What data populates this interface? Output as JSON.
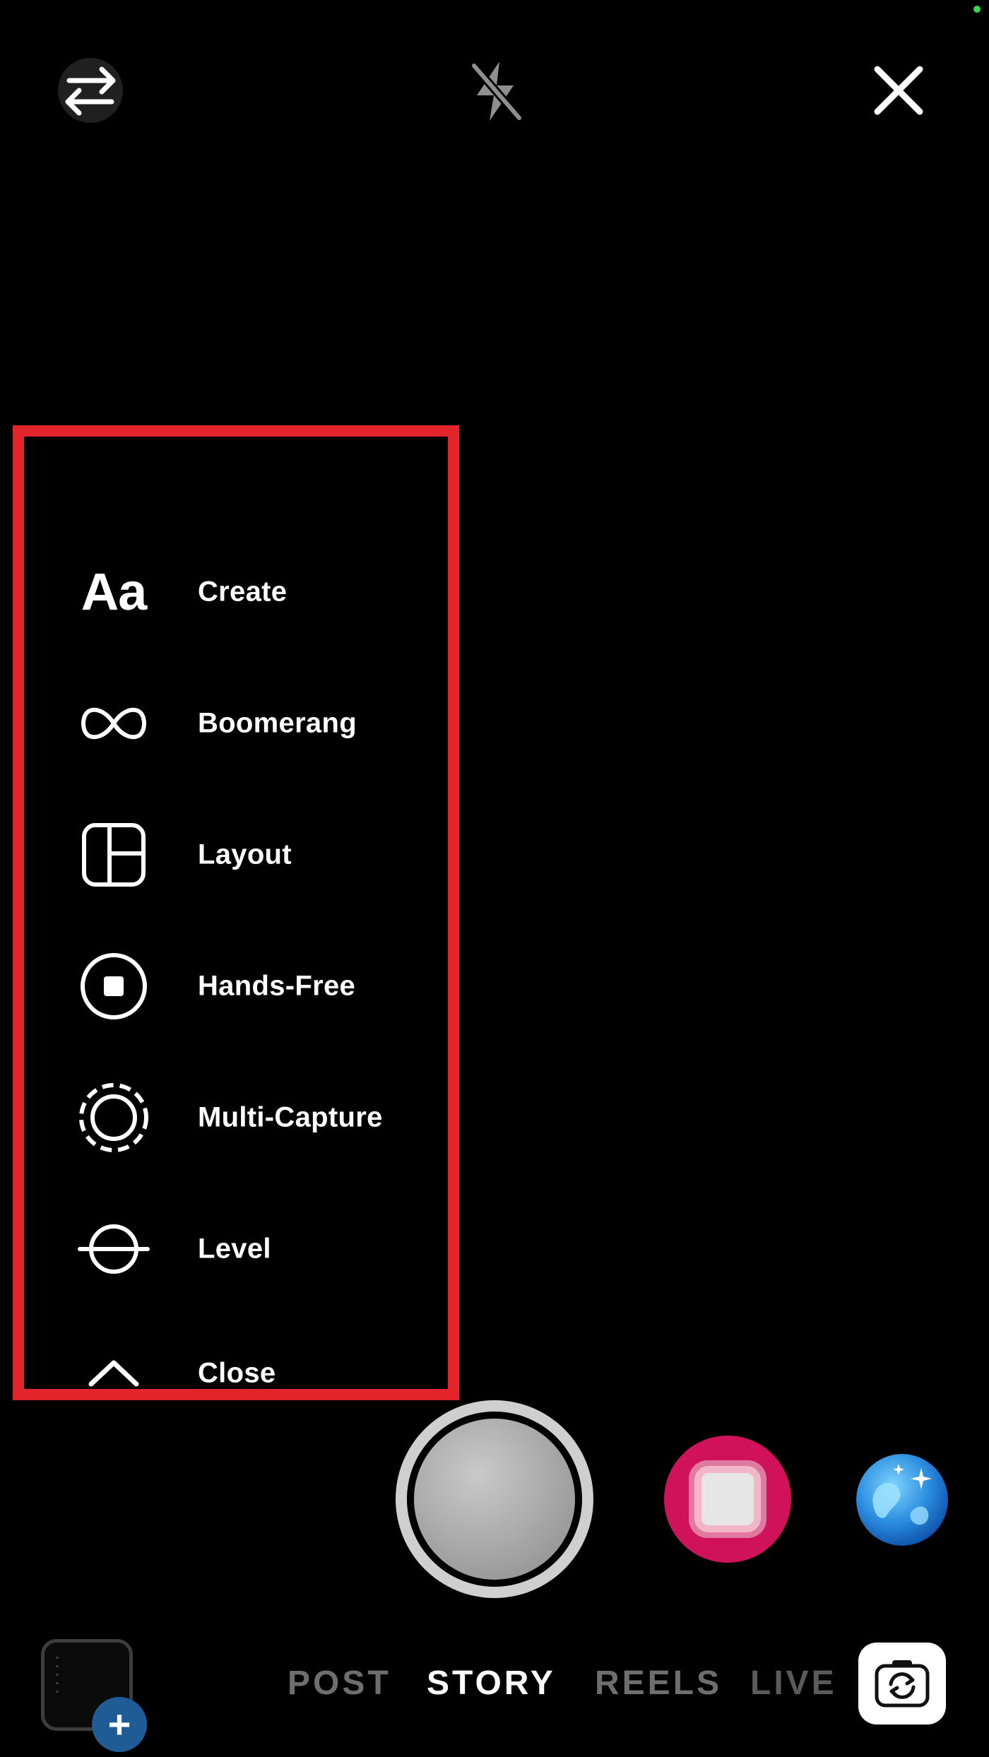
{
  "colors": {
    "background": "#000000",
    "highlight": "#e3242b",
    "status_dot": "#32d74b",
    "effect_bg": "#d0125a",
    "gallery_plus_bg": "#1f5b95",
    "tab_active": "#ffffff",
    "tab_inactive": "#6e6e6e"
  },
  "top_bar": {
    "switch_icon": "arrows-switch-icon",
    "flash_icon": "flash-off-icon",
    "close_icon": "close-icon"
  },
  "tools": {
    "items": [
      {
        "label": "Create",
        "icon": "text-aa-icon",
        "glyph": "Aa"
      },
      {
        "label": "Boomerang",
        "icon": "infinity-icon"
      },
      {
        "label": "Layout",
        "icon": "layout-grid-icon"
      },
      {
        "label": "Hands-Free",
        "icon": "record-stop-icon"
      },
      {
        "label": "Multi-Capture",
        "icon": "dashed-circle-icon"
      },
      {
        "label": "Level",
        "icon": "level-icon"
      },
      {
        "label": "Close",
        "icon": "chevron-up-icon"
      }
    ]
  },
  "capture": {
    "shutter_icon": "shutter-button",
    "effect_icon": "effect-filter-icon",
    "globe_icon": "effects-globe-icon"
  },
  "bottom_bar": {
    "gallery_plus": "+",
    "modes": [
      {
        "label": "POST",
        "active": false
      },
      {
        "label": "STORY",
        "active": true
      },
      {
        "label": "REELS",
        "active": false
      },
      {
        "label": "LIVE",
        "active": false
      }
    ],
    "flip_icon": "camera-flip-icon"
  }
}
